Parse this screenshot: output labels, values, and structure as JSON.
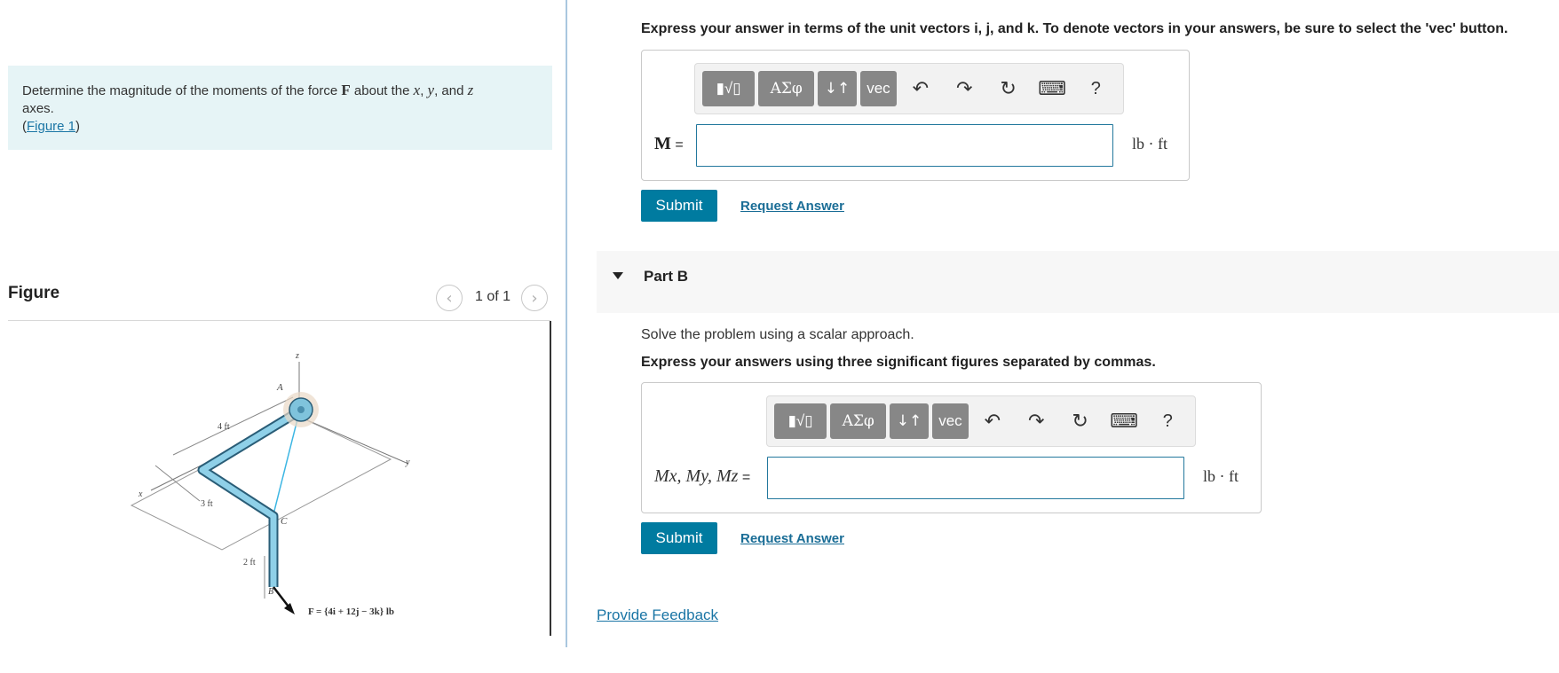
{
  "problem": {
    "text_before": "Determine the magnitude of the moments of the force ",
    "force_symbol": "F",
    "text_mid": " about the ",
    "axis_x": "x",
    "comma1": ", ",
    "axis_y": "y",
    "text_and": ", and ",
    "axis_z": "z",
    "text_axes": "axes.",
    "paren_open": "(",
    "figure_link": "Figure 1",
    "paren_close": ")"
  },
  "figure_panel": {
    "heading": "Figure",
    "count": "1 of 1",
    "prev_glyph": "‹",
    "next_glyph": "›",
    "labels": {
      "z": "z",
      "x": "x",
      "y": "y",
      "A": "A",
      "C": "C",
      "B": "B",
      "d4": "4 ft",
      "d3": "3 ft",
      "d2": "2 ft",
      "force": "F = {4i + 12j − 3k} lb"
    }
  },
  "part_a": {
    "instruction": "Express your answer in terms of the unit vectors i, j, and k. To denote vectors in your answers, be sure to select the 'vec' button.",
    "label": "M",
    "equals": " =",
    "unit": "lb · ft",
    "input_value": "",
    "submit_label": "Submit",
    "request_label": "Request Answer"
  },
  "toolbar": {
    "templates_glyph": "▮√▯",
    "greek_label": "ΑΣφ",
    "arrows_label": "↓↑",
    "vec_label": "vec",
    "undo_glyph": "↶",
    "redo_glyph": "↷",
    "reset_glyph": "↻",
    "keyboard_glyph": "⌨",
    "help_glyph": "?"
  },
  "part_b": {
    "title": "Part B",
    "desc": "Solve the problem using a scalar approach.",
    "instruction": "Express your answers using three significant figures separated by commas.",
    "label": "Mx, My, Mz",
    "equals": " =",
    "unit": "lb · ft",
    "input_value": "",
    "submit_label": "Submit",
    "request_label": "Request Answer"
  },
  "feedback": {
    "label": "Provide Feedback"
  },
  "colors": {
    "accent": "#007ba0",
    "link": "#1a75a5",
    "problem_bg": "#e6f4f6",
    "pipe": "#7fc3dc"
  }
}
